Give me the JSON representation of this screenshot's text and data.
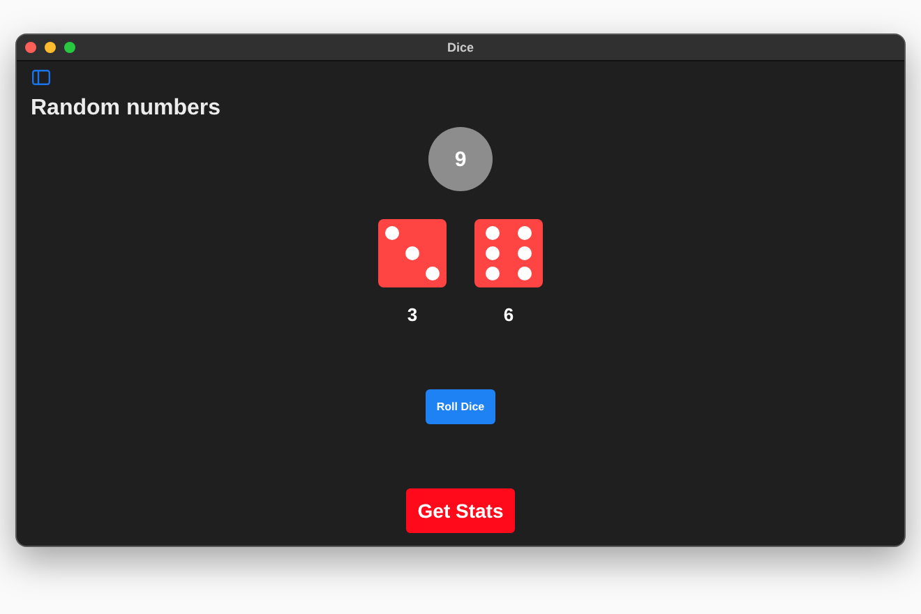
{
  "window": {
    "title": "Dice"
  },
  "heading": "Random numbers",
  "total": "9",
  "dice": [
    {
      "kind": "three",
      "label": "3"
    },
    {
      "kind": "six",
      "label": "6"
    }
  ],
  "buttons": [
    {
      "kind": "primary",
      "label": "Roll Dice"
    },
    {
      "kind": "danger",
      "label": "Get Stats"
    }
  ]
}
